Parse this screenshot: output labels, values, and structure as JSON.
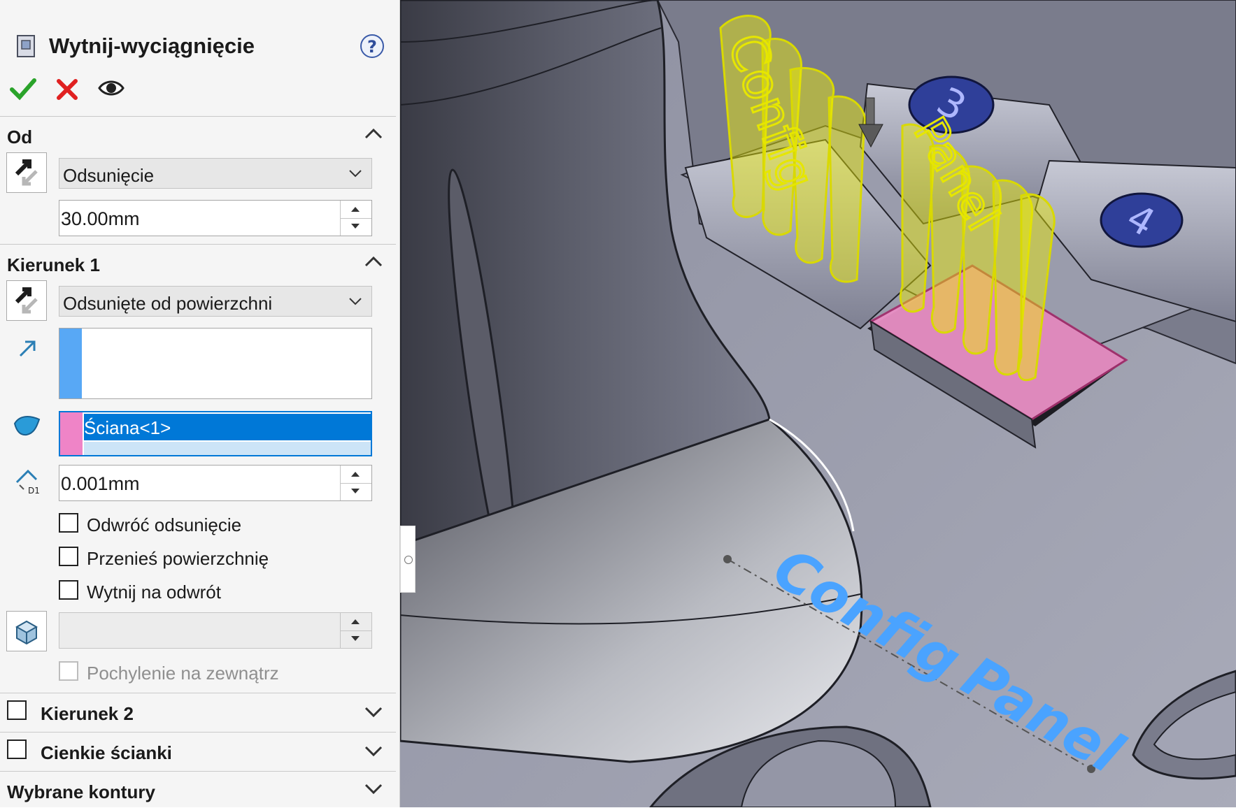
{
  "feature": {
    "title": "Wytnij-wyciągnięcie",
    "icons": [
      "help-icon",
      "ok-checkmark-icon",
      "cancel-x-icon",
      "preview-eye-icon"
    ]
  },
  "sections": {
    "od": {
      "title": "Od",
      "type_selected": "Odsunięcie",
      "offset_value": "30.00mm"
    },
    "kierunek1": {
      "title": "Kierunek 1",
      "end_condition": "Odsunięte od powierzchni",
      "face_selection": "Ściana<1>",
      "offset_value": "0.001mm",
      "options": [
        {
          "label": "Odwróć odsunięcie",
          "checked": false
        },
        {
          "label": "Przenieś powierzchnię",
          "checked": false
        },
        {
          "label": "Wytnij na odwrót",
          "checked": false
        }
      ],
      "draft_value": "",
      "draft_outward": {
        "label": "Pochylenie na zewnątrz",
        "checked": false,
        "disabled": true
      }
    },
    "kierunek2": {
      "title": "Kierunek 2",
      "checked": false
    },
    "cienkie": {
      "title": "Cienkie ścianki",
      "checked": false
    },
    "kontury": {
      "title": "Wybrane kontury"
    }
  },
  "viewport": {
    "key_labels": [
      "3",
      "4"
    ],
    "extrude_texts": [
      "Config",
      "Panel"
    ],
    "sketch_texts": [
      "Config",
      "Panel"
    ],
    "colors": {
      "extrude_preview": "#f0f000",
      "selected_face": "#e98fc5",
      "sketch_text": "#4aa3ff",
      "key_badge": "#2f3f99"
    }
  }
}
